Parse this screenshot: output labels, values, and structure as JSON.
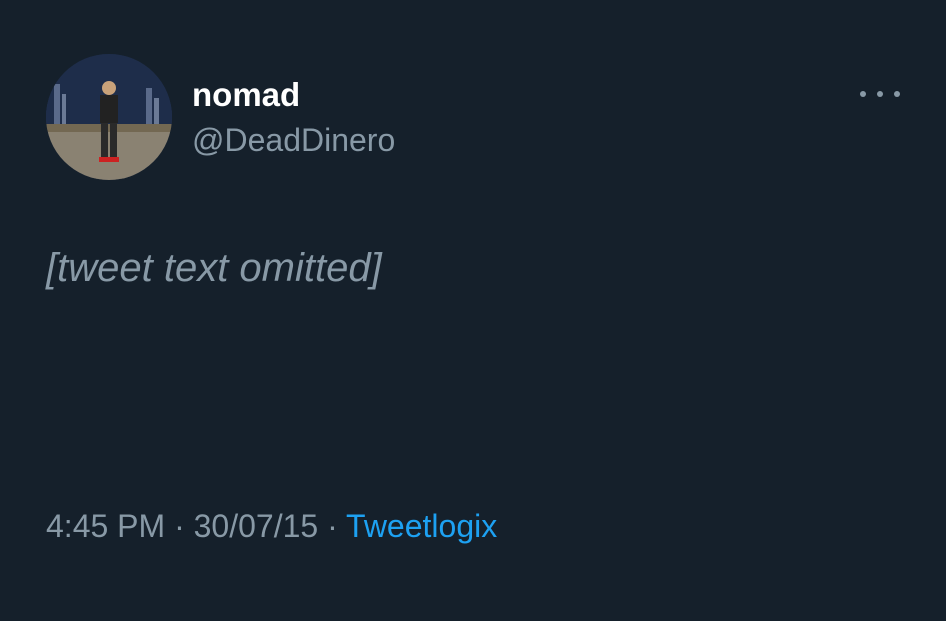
{
  "author": {
    "name": "nomad",
    "handle": "@DeadDinero"
  },
  "tweet": {
    "text": "[tweet text omitted]"
  },
  "meta": {
    "time": "4:45 PM",
    "separator": " · ",
    "date": "30/07/15",
    "source": "Tweetlogix"
  },
  "icons": {
    "more": "more-options-icon",
    "avatar": "profile-photo"
  },
  "colors": {
    "background": "#15202b",
    "primary_text": "#ffffff",
    "secondary_text": "#8899a6",
    "link": "#1da1f2"
  }
}
